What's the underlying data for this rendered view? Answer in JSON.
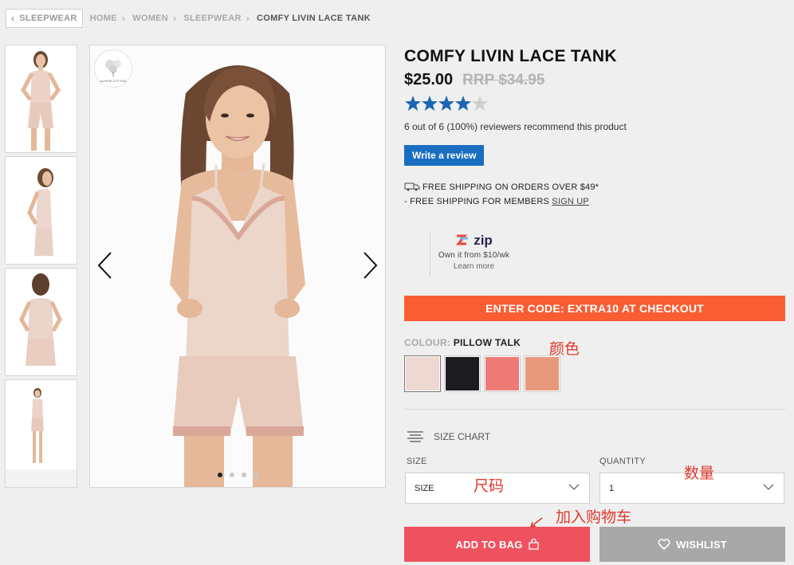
{
  "breadcrumb": {
    "back_label": "SLEEPWEAR",
    "items": [
      "HOME",
      "WOMEN",
      "SLEEPWEAR",
      "COMFY LIVIN LACE TANK"
    ]
  },
  "product": {
    "title": "COMFY LIVIN LACE TANK",
    "price": "$25.00",
    "rrp": "RRP $34.95",
    "rating": 4.5,
    "recommend_text": "6 out of 6 (100%) reviewers recommend this product",
    "review_button": "Write a review"
  },
  "shipping": {
    "line1": "FREE SHIPPING ON ORDERS OVER $49*",
    "line2_prefix": "- FREE SHIPPING FOR MEMBERS",
    "line2_link": "SIGN UP"
  },
  "zip": {
    "brand": "zip",
    "line": "Own it from $10/wk",
    "learn": "Learn more"
  },
  "promo": "ENTER CODE: EXTRA10 AT CHECKOUT",
  "colour": {
    "label": "COLOUR:",
    "selected": "PILLOW TALK",
    "swatches": [
      "#edd8d2",
      "#1c1c20",
      "#ee7b78",
      "#e8997c"
    ]
  },
  "size_chart": "SIZE CHART",
  "size": {
    "label": "SIZE",
    "value": "SIZE"
  },
  "quantity": {
    "label": "QUANTITY",
    "value": "1"
  },
  "buttons": {
    "add_to_bag": "ADD TO BAG",
    "wishlist": "WISHLIST"
  },
  "annotations": {
    "colour": "颜色",
    "size": "尺码",
    "quantity": "数量",
    "add_to_cart": "加入购物车"
  },
  "badge_text": "AUSSIE COTTON",
  "colors": {
    "accent": "#fb5d33",
    "bag": "#ee525e",
    "review": "#1a6ec2",
    "star": "#1b66b3"
  }
}
